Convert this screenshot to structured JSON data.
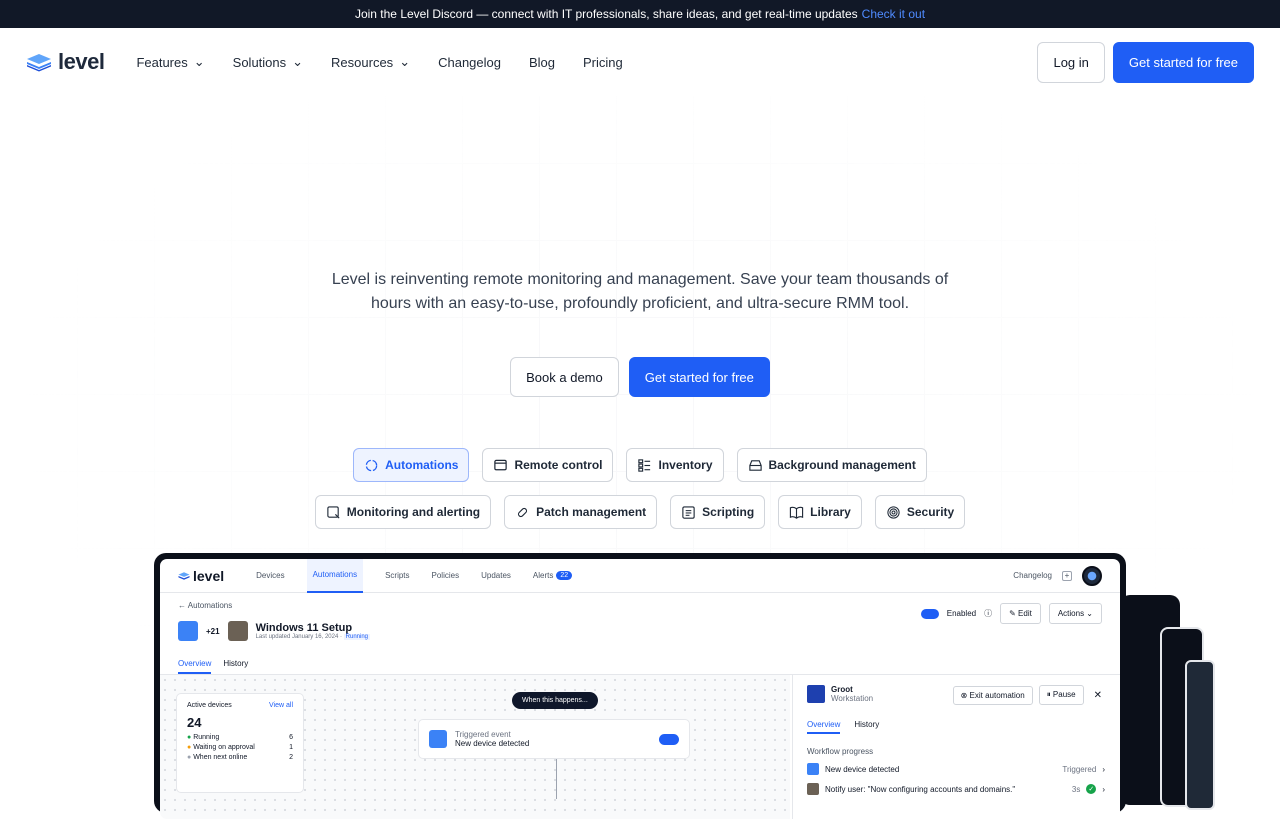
{
  "banner": {
    "text": "Join the Level Discord — connect with IT professionals, share ideas, and get real-time updates",
    "link": "Check it out"
  },
  "nav": {
    "logo": "level",
    "items": [
      "Features",
      "Solutions",
      "Resources",
      "Changelog",
      "Blog",
      "Pricing"
    ],
    "login": "Log in",
    "cta": "Get started for free"
  },
  "hero": {
    "text": "Level is reinventing remote monitoring and management. Save your team thousands of hours with an easy-to-use, profoundly proficient, and ultra-secure RMM tool.",
    "demo": "Book a demo",
    "cta": "Get started for free"
  },
  "chips": {
    "row1": [
      "Automations",
      "Remote control",
      "Inventory",
      "Background management"
    ],
    "row2": [
      "Monitoring and alerting",
      "Patch management",
      "Scripting",
      "Library",
      "Security"
    ],
    "active": "Automations"
  },
  "app": {
    "logo": "level",
    "tabs": [
      "Devices",
      "Automations",
      "Scripts",
      "Policies",
      "Updates",
      "Alerts"
    ],
    "alerts_count": "22",
    "changelog": "Changelog",
    "breadcrumb": "Automations",
    "count": "+21",
    "title": "Windows 11 Setup",
    "subtitle": "Last updated January 16, 2024",
    "status": "Running",
    "subtabs": [
      "Overview",
      "History"
    ],
    "enabled": "Enabled",
    "edit": "Edit",
    "actions": "Actions",
    "active_devices": {
      "title": "Active devices",
      "view_all": "View all",
      "count": "24",
      "rows": [
        {
          "label": "Running",
          "value": "6",
          "color": "#16a34a"
        },
        {
          "label": "Waiting on approval",
          "value": "1",
          "color": "#f59e0b"
        },
        {
          "label": "When next online",
          "value": "2",
          "color": "#9ca3af"
        }
      ]
    },
    "flow": {
      "pill": "When this happens...",
      "event_label": "Triggered event",
      "event": "New device detected"
    },
    "panel": {
      "name": "Groot",
      "type": "Workstation",
      "exit": "Exit automation",
      "pause": "Pause",
      "tabs": [
        "Overview",
        "History"
      ],
      "progress_title": "Workflow progress",
      "steps": [
        {
          "label": "New device detected",
          "status": "Triggered"
        },
        {
          "label": "Notify user: \"Now configuring accounts and domains.\"",
          "status": "3s"
        }
      ]
    }
  },
  "colors": {
    "primary": "#1f5ef5",
    "dark": "#111827"
  }
}
